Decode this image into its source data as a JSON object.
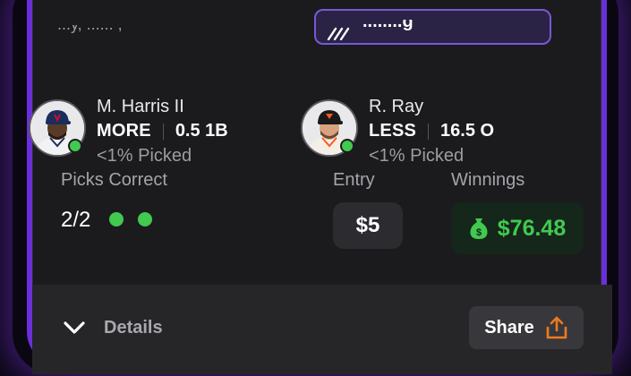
{
  "colors": {
    "accent_purple": "#6b2fd9",
    "card_bg": "#1b1b1d",
    "success_green": "#41c950",
    "share_orange": "#f07a1c"
  },
  "header": {
    "partial_text": "...y, ...... ,",
    "chip_text": "........g"
  },
  "players": [
    {
      "name": "M. Harris II",
      "direction": "MORE",
      "line": "0.5 1B",
      "picked": "<1% Picked",
      "avatar_icon": "player-avatar-harris",
      "status_icon": "online-status-dot"
    },
    {
      "name": "R. Ray",
      "direction": "LESS",
      "line": "16.5 O",
      "picked": "<1% Picked",
      "avatar_icon": "player-avatar-ray",
      "status_icon": "online-status-dot"
    }
  ],
  "summary": {
    "picks_label": "Picks Correct",
    "picks_value": "2/2",
    "picks_correct_count": 2,
    "entry_label": "Entry",
    "entry_value": "$5",
    "winnings_label": "Winnings",
    "winnings_value": "$76.48",
    "winnings_icon": "money-bag-icon"
  },
  "footer": {
    "details_label": "Details",
    "details_icon": "chevron-down-icon",
    "share_label": "Share",
    "share_icon": "share-upload-icon"
  }
}
